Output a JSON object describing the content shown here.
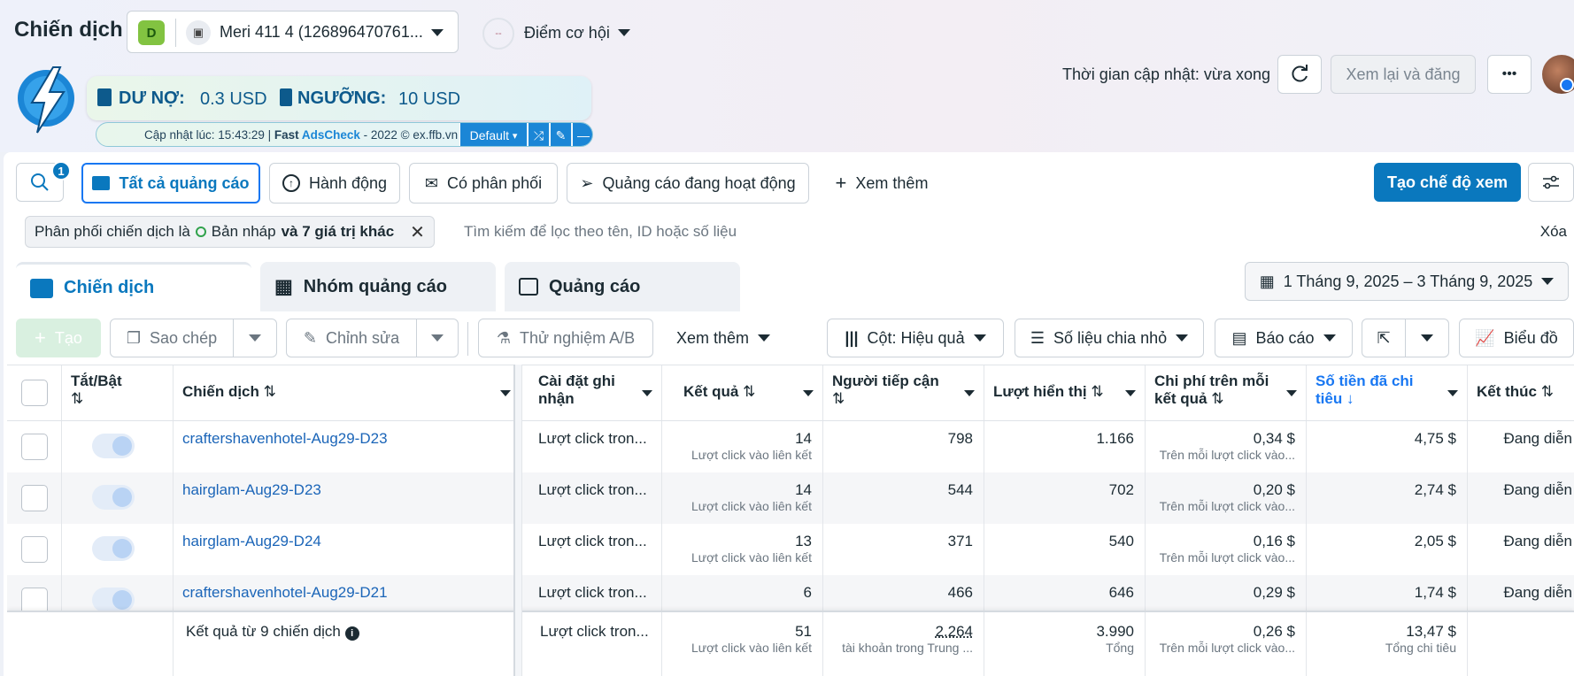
{
  "header": {
    "title": "Chiến dịch",
    "account": {
      "badge": "D",
      "icon": "▣",
      "name": "Meri 411 4 (126896470761..."
    },
    "opportunity": {
      "score": "--",
      "label": "Điểm cơ hội"
    },
    "update_time": "Thời gian cập nhật: vừa xong",
    "review_publish": "Xem lại và đăng",
    "more": "•••"
  },
  "extension": {
    "debt_label": "DƯ NỢ:",
    "debt_value": "0.3 USD",
    "threshold_label": "NGƯỠNG:",
    "threshold_value": "10 USD",
    "updated_prefix": "Cập nhật lúc: 15:43:29 | ",
    "brand_fast": "Fast ",
    "brand_ads": "AdsCheck",
    "brand_suffix": " - 2022 © ex.ffb.vn",
    "mode": "Default"
  },
  "toolbar": {
    "search_badge": "1",
    "all_ads": "Tất cả quảng cáo",
    "actions": "Hành động",
    "delivery": "Có phân phối",
    "active_ads": "Quảng cáo đang hoạt động",
    "see_more": "Xem thêm",
    "create_view": "Tạo chế độ xem"
  },
  "filter": {
    "prefix": "Phân phối chiến dịch là",
    "value": "Bản nháp",
    "more": "và 7 giá trị khác",
    "search_placeholder": "Tìm kiếm để lọc theo tên, ID hoặc số liệu",
    "clear": "Xóa"
  },
  "tabs": {
    "campaigns": "Chiến dịch",
    "adsets": "Nhóm quảng cáo",
    "ads": "Quảng cáo"
  },
  "date_range": "1 Tháng 9, 2025 – 3 Tháng 9, 2025",
  "actions": {
    "create": "Tạo",
    "copy": "Sao chép",
    "edit": "Chỉnh sửa",
    "ab_test": "Thử nghiệm A/B",
    "more": "Xem thêm",
    "columns": "Cột: Hiệu quả",
    "breakdown": "Số liệu chia nhỏ",
    "reports": "Báo cáo",
    "chart": "Biểu đồ"
  },
  "table": {
    "headers": {
      "toggle": "Tắt/Bật",
      "campaign": "Chiến dịch",
      "attribution": "Cài đặt ghi nhận",
      "results": "Kết quả",
      "reach": "Người tiếp cận",
      "impressions": "Lượt hiển thị",
      "cost_per_result": "Chi phí trên mỗi kết quả",
      "amount_spent": "Số tiền đã chi tiêu",
      "ends": "Kết thúc"
    },
    "rows": [
      {
        "name": "craftershavenhotel-Aug29-D23",
        "attribution": "Lượt click tron...",
        "results": "14",
        "results_sub": "Lượt click vào liên kết",
        "reach": "798",
        "impressions": "1.166",
        "cpr": "0,34 $",
        "cpr_sub": "Trên mỗi lượt click vào...",
        "spent": "4,75 $",
        "ends": "Đang diễn"
      },
      {
        "name": "hairglam-Aug29-D23",
        "attribution": "Lượt click tron...",
        "results": "14",
        "results_sub": "Lượt click vào liên kết",
        "reach": "544",
        "impressions": "702",
        "cpr": "0,20 $",
        "cpr_sub": "Trên mỗi lượt click vào...",
        "spent": "2,74 $",
        "ends": "Đang diễn"
      },
      {
        "name": "hairglam-Aug29-D24",
        "attribution": "Lượt click tron...",
        "results": "13",
        "results_sub": "Lượt click vào liên kết",
        "reach": "371",
        "impressions": "540",
        "cpr": "0,16 $",
        "cpr_sub": "Trên mỗi lượt click vào...",
        "spent": "2,05 $",
        "ends": "Đang diễn"
      },
      {
        "name": "craftershavenhotel-Aug29-D21",
        "attribution": "Lượt click tron...",
        "results": "6",
        "results_sub": "",
        "reach": "466",
        "impressions": "646",
        "cpr": "0,29 $",
        "cpr_sub": "",
        "spent": "1,74 $",
        "ends": "Đang diễn"
      }
    ],
    "summary": {
      "label": "Kết quả từ 9 chiến dịch",
      "attribution": "Lượt click tron...",
      "results": "51",
      "results_sub": "Lượt click vào liên kết",
      "reach": "2.264",
      "reach_sub": "tài khoản trong Trung ...",
      "impressions": "3.990",
      "impressions_sub": "Tổng",
      "cpr": "0,26 $",
      "cpr_sub": "Trên mỗi lượt click vào...",
      "spent": "13,47 $",
      "spent_sub": "Tổng chi tiêu"
    }
  },
  "colors": {
    "primary": "#0a78be",
    "link": "#1b65b8",
    "accent": "#1877f2"
  }
}
